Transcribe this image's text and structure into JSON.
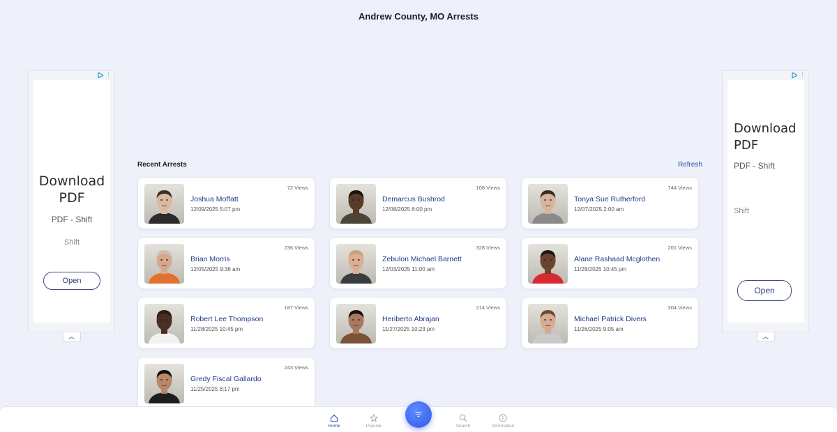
{
  "page_title": "Andrew County, MO Arrests",
  "ads": {
    "left": {
      "title": "Download PDF",
      "subtitle": "PDF - Shift",
      "brand": "Shift",
      "button": "Open"
    },
    "right": {
      "title": "Download PDF",
      "subtitle": "PDF - Shift",
      "brand": "Shift",
      "button": "Open"
    }
  },
  "section": {
    "title": "Recent Arrests",
    "refresh_label": "Refresh"
  },
  "arrests": [
    {
      "name": "Joshua Moffatt",
      "date": "12/09/2025 5:07 pm",
      "views": "72 Views",
      "skin": "#d9b9a0",
      "shirt": "#2b2b2b",
      "hair": "#3a2d24"
    },
    {
      "name": "Demarcus Bushrod",
      "date": "12/08/2025 6:00 pm",
      "views": "108 Views",
      "skin": "#5a3a28",
      "shirt": "#4a4538",
      "hair": "#1b1410"
    },
    {
      "name": "Tonya Sue Rutherford",
      "date": "12/07/2025 2:00 am",
      "views": "744 Views",
      "skin": "#d8b49c",
      "shirt": "#8a8a8a",
      "hair": "#3b2a20"
    },
    {
      "name": "Brian Morris",
      "date": "12/05/2025 9:36 am",
      "views": "236 Views",
      "skin": "#d7a88e",
      "shirt": "#e0722f",
      "hair": "#cbbfb5"
    },
    {
      "name": "Zebulon Michael Barnett",
      "date": "12/03/2025 11:00 am",
      "views": "328 Views",
      "skin": "#dcae94",
      "shirt": "#3a3c42",
      "hair": "#c7a37a"
    },
    {
      "name": "Alane Rashaad Mcglothen",
      "date": "11/28/2025 10:45 pm",
      "views": "201 Views",
      "skin": "#6a4430",
      "shirt": "#d92a32",
      "hair": "#1e1612"
    },
    {
      "name": "Robert Lee Thompson",
      "date": "11/28/2025 10:45 pm",
      "views": "187 Views",
      "skin": "#4a2e22",
      "shirt": "#f2f2f2",
      "hair": "#2a1c16"
    },
    {
      "name": "Heriberto Abrajan",
      "date": "11/27/2025 10:23 pm",
      "views": "214 Views",
      "skin": "#a8795c",
      "shirt": "#7a5236",
      "hair": "#161210"
    },
    {
      "name": "Michael Patrick Divers",
      "date": "11/26/2025 9:05 am",
      "views": "304 Views",
      "skin": "#d6ab92",
      "shirt": "#c9c9cc",
      "hair": "#6a4a34"
    },
    {
      "name": "Gredy Fiscal Gallardo",
      "date": "11/25/2025 8:17 pm",
      "views": "243 Views",
      "skin": "#b88868",
      "shirt": "#1e1e1e",
      "hair": "#141010"
    }
  ],
  "nav": {
    "home": "Home",
    "popular": "Popular",
    "search": "Search",
    "information": "Information"
  },
  "colors": {
    "accent": "#2f57e8",
    "link": "#253b85",
    "background": "#eef1fa"
  }
}
